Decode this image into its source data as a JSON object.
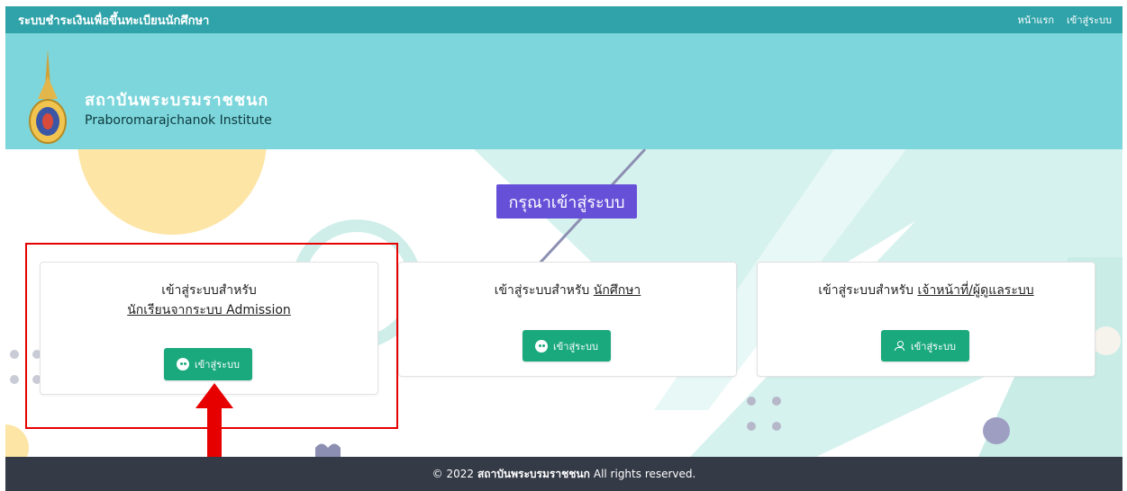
{
  "topbar": {
    "brand": "ระบบชำระเงินเพื่อขึ้นทะเบียนนักศึกษา",
    "nav": {
      "home": "หน้าแรก",
      "login": "เข้าสู่ระบบ"
    }
  },
  "header": {
    "name_th": "สถาบันพระบรมราชชนก",
    "name_en": "Praboromarajchanok Institute"
  },
  "page_title": "กรุณาเข้าสู่ระบบ",
  "cards": [
    {
      "line1": "เข้าสู่ระบบสำหรับ",
      "line2": "นักเรียนจากระบบ Admission",
      "button": "เข้าสู่ระบบ"
    },
    {
      "prefix": "เข้าสู่ระบบสำหรับ",
      "target": "นักศึกษา",
      "button": "เข้าสู่ระบบ"
    },
    {
      "prefix": "เข้าสู่ระบบสำหรับ",
      "target": "เจ้าหน้าที่/ผู้ดูแลระบบ",
      "button": "เข้าสู่ระบบ"
    }
  ],
  "footer": {
    "copyright": "© 2022",
    "org": "สถาบันพระบรมราชชนก",
    "rights": "All rights reserved."
  },
  "colors": {
    "topbar": "#2fa3a9",
    "header": "#7cd6db",
    "title_box": "#6750d8",
    "button": "#1aa97c",
    "footer": "#343a46",
    "highlight": "#e60000"
  }
}
